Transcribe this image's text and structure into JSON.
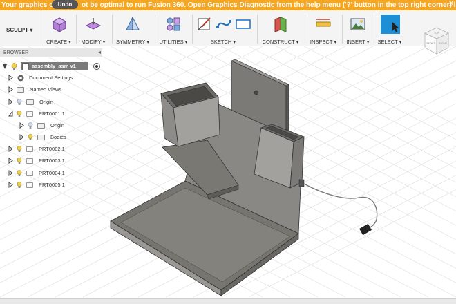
{
  "warning": {
    "text_left": "Your graphics ca",
    "undo_label": "Undo",
    "text_right": "ot be optimal to run Fusion 360. Open Graphics Diagnostic from the help menu ('?' button in the top right corner) l...",
    "close": "X"
  },
  "toolbar": {
    "workspace": "SCULPT ▾",
    "groups": [
      {
        "label": "CREATE ▾"
      },
      {
        "label": "MODIFY ▾"
      },
      {
        "label": "SYMMETRY ▾"
      },
      {
        "label": "UTILITIES ▾"
      },
      {
        "label": "SKETCH ▾"
      },
      {
        "label": "CONSTRUCT ▾"
      },
      {
        "label": "INSPECT ▾"
      },
      {
        "label": "INSERT ▾"
      },
      {
        "label": "SELECT ▾"
      }
    ]
  },
  "viewcube": {
    "top": "TOP",
    "left": "FRONT",
    "right": "RIGHT"
  },
  "browser": {
    "header": "BROWSER",
    "root": "assembly_asm v1",
    "items": [
      {
        "label": "Document Settings"
      },
      {
        "label": "Named Views"
      },
      {
        "label": "Origin"
      },
      {
        "label": "PRT0001:1"
      },
      {
        "label": "Origin"
      },
      {
        "label": "Bodies"
      },
      {
        "label": "PRT0002:1"
      },
      {
        "label": "PRT0003:1"
      },
      {
        "label": "PRT0004:1"
      },
      {
        "label": "PRT0005:1"
      }
    ]
  },
  "colors": {
    "warning": "#f5a623",
    "select_accent": "#1d8fd6",
    "model_base": "#8c8a86",
    "model_dark": "#5e5c58"
  }
}
